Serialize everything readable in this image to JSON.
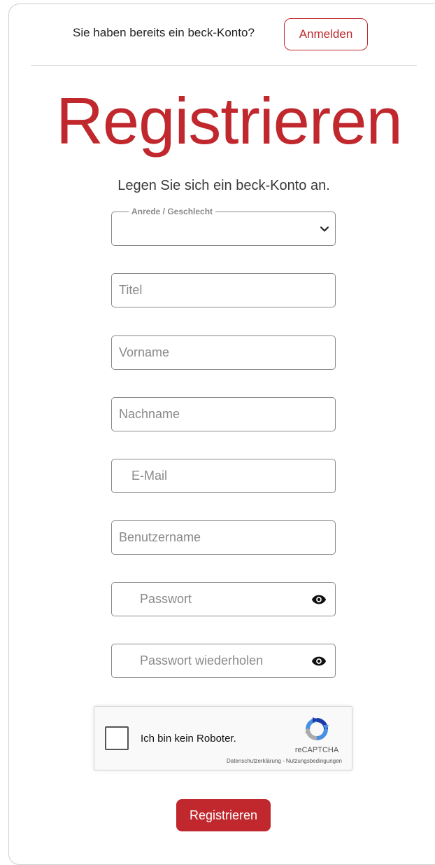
{
  "header": {
    "login_prompt": "Sie haben bereits ein beck-Konto?",
    "login_label": "Anmelden"
  },
  "page": {
    "title": "Registrieren",
    "subtitle": "Legen Sie sich ein beck-Konto an."
  },
  "form": {
    "salutation": {
      "label": "Anrede / Geschlecht",
      "selected": ""
    },
    "title_placeholder": "Titel",
    "firstname_placeholder": "Vorname",
    "lastname_placeholder": "Nachname",
    "email_placeholder": "E-Mail",
    "username_placeholder": "Benutzername",
    "password_placeholder": "Passwort",
    "password_repeat_placeholder": "Passwort wiederholen",
    "submit_label": "Registrieren"
  },
  "captcha": {
    "label": "Ich bin kein Roboter.",
    "brand": "reCAPTCHA",
    "privacy": "Datenschutzerklärung",
    "separator": " - ",
    "terms": "Nutzungsbedingungen"
  },
  "colors": {
    "accent": "#c0282d",
    "border": "#8a8a8a"
  },
  "icons": {
    "select_toggle": "chevron-down-icon",
    "password_visibility": "eye-icon",
    "captcha_logo": "recaptcha-logo-icon"
  }
}
